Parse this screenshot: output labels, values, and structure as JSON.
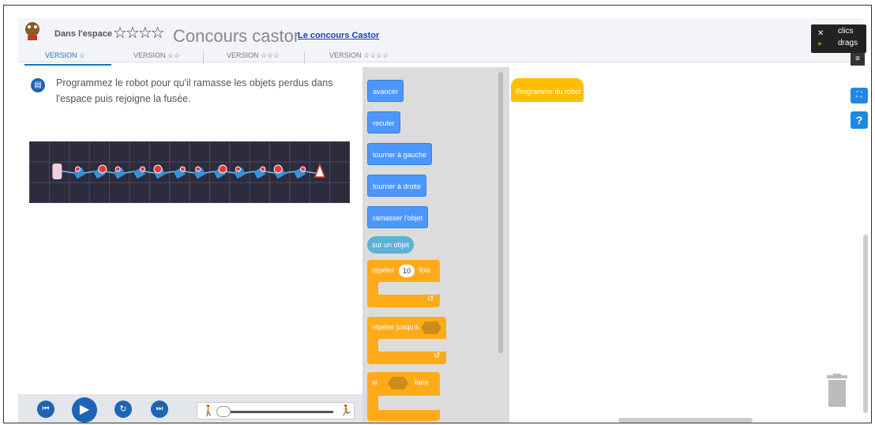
{
  "header": {
    "title_small": "Dans l'espace",
    "title_stars": "☆☆☆☆",
    "title_big": "Concours castor",
    "link": "Le concours Castor"
  },
  "tabs": [
    {
      "label": "VERSION ☆",
      "active": true
    },
    {
      "label": "VERSION ☆☆",
      "active": false
    },
    {
      "label": "VERSION ☆☆☆",
      "active": false
    },
    {
      "label": "VERSION ☆☆☆☆",
      "active": false
    }
  ],
  "counter": {
    "clics_label": "clics",
    "drags_label": "drags"
  },
  "menu_glyph": "≡",
  "instruction": "Programmez le robot pour qu'il ramasse les objets perdus dans l'espace puis rejoigne la fusée.",
  "palette": {
    "blocks": [
      "avancer",
      "reculer",
      "tourner à gauche",
      "tourner à droite",
      "ramasser l'objet"
    ],
    "sensor": "sur un objet",
    "repeat_label": "répéter",
    "repeat_value": "10",
    "repeat_suffix": "fois",
    "repeat_until_label": "répéter jusqu'à",
    "if_label": "si",
    "if_suffix": "faire"
  },
  "workspace": {
    "hat_label": "Programme du robot"
  },
  "colors": {
    "accent": "#1e63b5",
    "motion": "#4c97ff",
    "control": "#ffab19",
    "event": "#ffbf00"
  }
}
